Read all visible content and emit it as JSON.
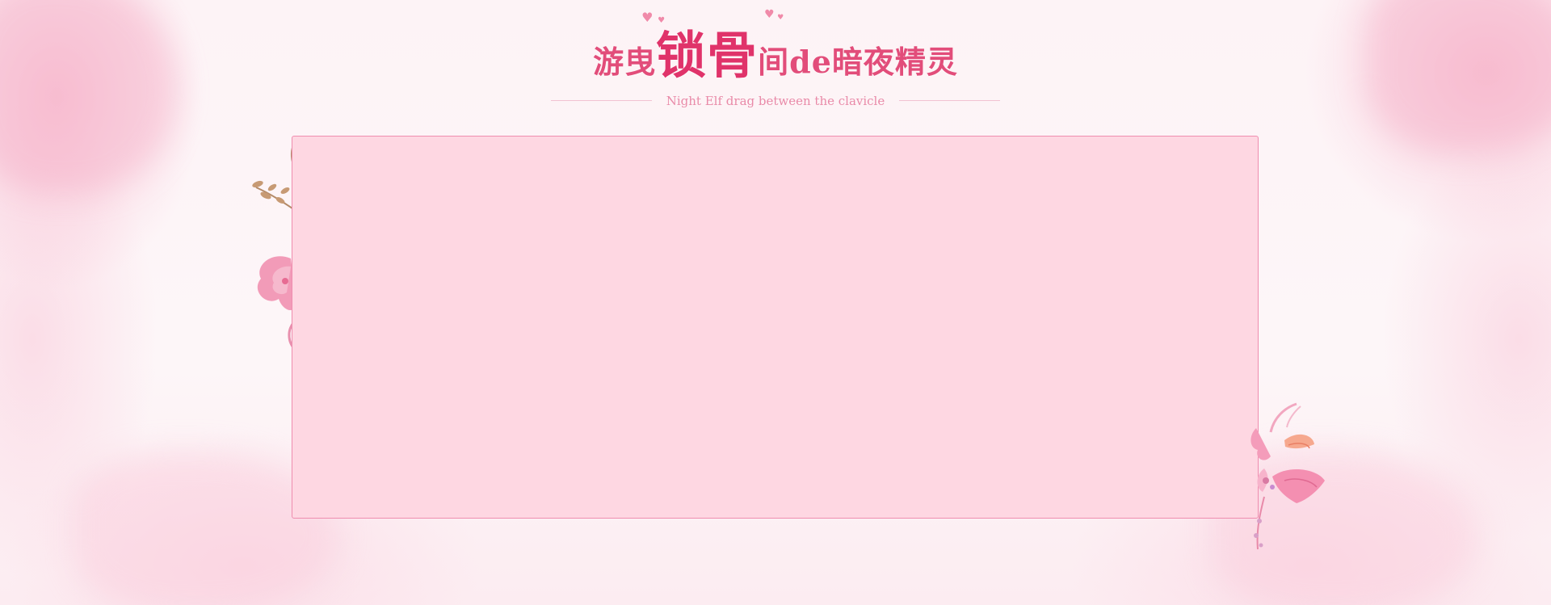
{
  "title": {
    "part1": "游曳",
    "part2": "锁骨",
    "part3": "间de暗夜精灵"
  },
  "subtitle": "Night Elf drag between the clavicle",
  "colors": {
    "accent": "#e0336a",
    "panel": "#fed7e2",
    "panel_border": "#ef8daf",
    "subtitle": "#e98aa8"
  },
  "decorations": {
    "title_hearts": "heart-icon",
    "left_flower": "flower-icon",
    "left_branch": "branch-icon",
    "right_flower": "lily-icon"
  }
}
